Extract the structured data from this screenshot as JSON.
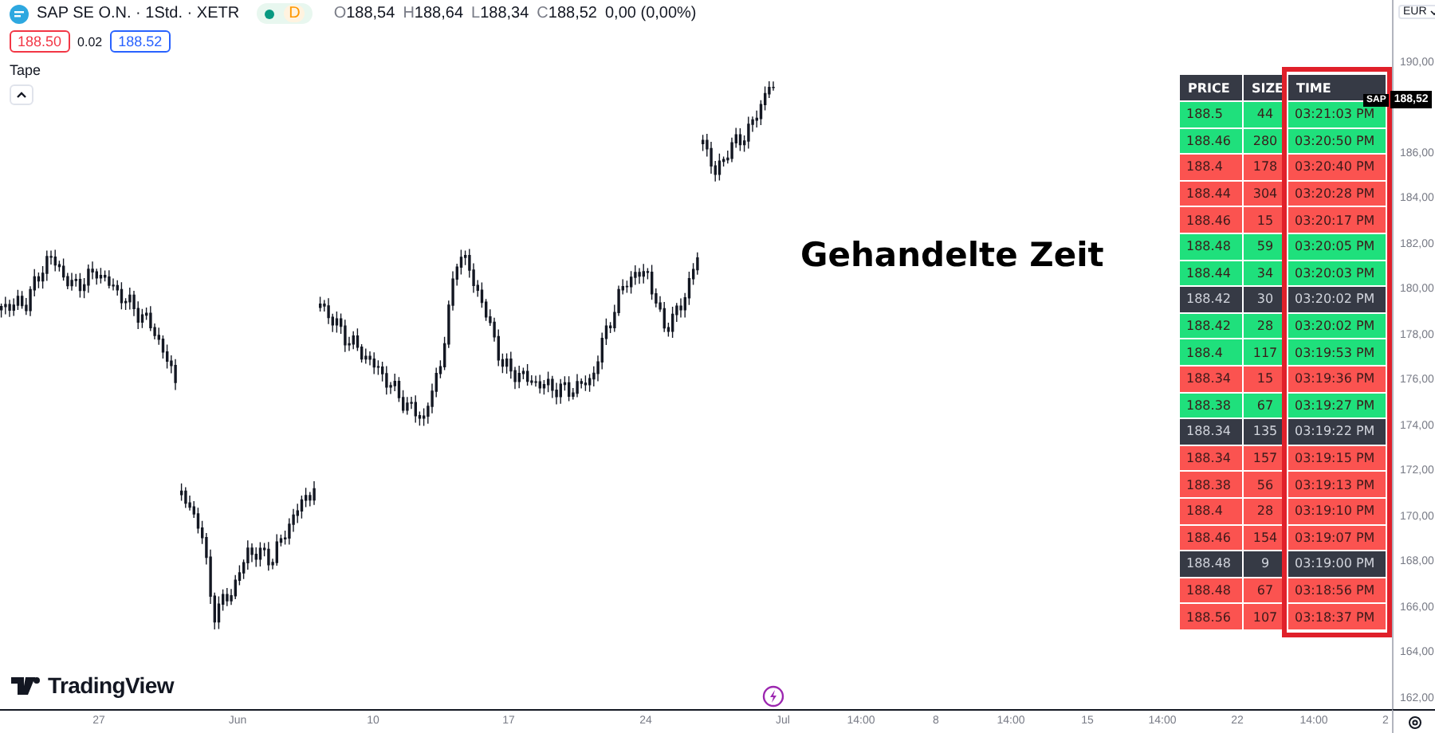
{
  "symbol": {
    "title": "SAP SE O.N. · 1Std. · XETR",
    "market_open": true,
    "badge": "D"
  },
  "ohlc": [
    {
      "label": "O",
      "value": "188,54"
    },
    {
      "label": "H",
      "value": "188,64"
    },
    {
      "label": "L",
      "value": "188,34"
    },
    {
      "label": "C",
      "value": "188,52"
    }
  ],
  "change": "0,00 (0,00%)",
  "quote": {
    "bid": "188.50",
    "spread": "0.02",
    "ask": "188.52"
  },
  "indicator": {
    "title": "Tape"
  },
  "tape": {
    "columns": [
      "PRICE",
      "SIZE",
      "TIME"
    ],
    "rows": [
      {
        "price": "188.5",
        "size": "44",
        "time": "03:21:03 PM",
        "color": "#1fe07c"
      },
      {
        "price": "188.46",
        "size": "280",
        "time": "03:20:50 PM",
        "color": "#1fe07c"
      },
      {
        "price": "188.4",
        "size": "178",
        "time": "03:20:40 PM",
        "color": "#fb5350"
      },
      {
        "price": "188.44",
        "size": "304",
        "time": "03:20:28 PM",
        "color": "#fb5350"
      },
      {
        "price": "188.46",
        "size": "15",
        "time": "03:20:17 PM",
        "color": "#fb5350"
      },
      {
        "price": "188.48",
        "size": "59",
        "time": "03:20:05 PM",
        "color": "#1fe07c"
      },
      {
        "price": "188.44",
        "size": "34",
        "time": "03:20:03 PM",
        "color": "#1fe07c"
      },
      {
        "price": "188.42",
        "size": "30",
        "time": "03:20:02 PM",
        "color": "#363a45"
      },
      {
        "price": "188.42",
        "size": "28",
        "time": "03:20:02 PM",
        "color": "#1fe07c"
      },
      {
        "price": "188.4",
        "size": "117",
        "time": "03:19:53 PM",
        "color": "#1fe07c"
      },
      {
        "price": "188.34",
        "size": "15",
        "time": "03:19:36 PM",
        "color": "#fb5350"
      },
      {
        "price": "188.38",
        "size": "67",
        "time": "03:19:27 PM",
        "color": "#1fe07c"
      },
      {
        "price": "188.34",
        "size": "135",
        "time": "03:19:22 PM",
        "color": "#363a45"
      },
      {
        "price": "188.34",
        "size": "157",
        "time": "03:19:15 PM",
        "color": "#fb5350"
      },
      {
        "price": "188.38",
        "size": "56",
        "time": "03:19:13 PM",
        "color": "#fb5350"
      },
      {
        "price": "188.4",
        "size": "28",
        "time": "03:19:10 PM",
        "color": "#fb5350"
      },
      {
        "price": "188.46",
        "size": "154",
        "time": "03:19:07 PM",
        "color": "#fb5350"
      },
      {
        "price": "188.48",
        "size": "9",
        "time": "03:19:00 PM",
        "color": "#363a45"
      },
      {
        "price": "188.48",
        "size": "67",
        "time": "03:18:56 PM",
        "color": "#fb5350"
      },
      {
        "price": "188.56",
        "size": "107",
        "time": "03:18:37 PM",
        "color": "#fb5350"
      }
    ]
  },
  "annotation": "Gehandelte Zeit",
  "logo": "TradingView",
  "price_axis": {
    "currency": "EUR",
    "items": [
      {
        "kind": "label",
        "text": "190,00"
      },
      {
        "kind": "tag",
        "symbol": "SAP",
        "text": "188,52"
      },
      {
        "kind": "label",
        "text": "186,00"
      },
      {
        "kind": "label",
        "text": "184,00"
      },
      {
        "kind": "label",
        "text": "182,00"
      },
      {
        "kind": "label",
        "text": "180,00"
      },
      {
        "kind": "label",
        "text": "178,00"
      },
      {
        "kind": "label",
        "text": "176,00"
      },
      {
        "kind": "label",
        "text": "174,00"
      },
      {
        "kind": "label",
        "text": "172,00"
      },
      {
        "kind": "label",
        "text": "170,00"
      },
      {
        "kind": "label",
        "text": "168,00"
      },
      {
        "kind": "label",
        "text": "166,00"
      },
      {
        "kind": "label",
        "text": "164,00"
      },
      {
        "kind": "label",
        "text": "162,00"
      }
    ]
  },
  "time_axis": [
    "27",
    "Jun",
    "10",
    "17",
    "24",
    "Jul",
    "14:00",
    "8",
    "14:00",
    "15",
    "14:00",
    "22",
    "14:00",
    "2"
  ]
}
